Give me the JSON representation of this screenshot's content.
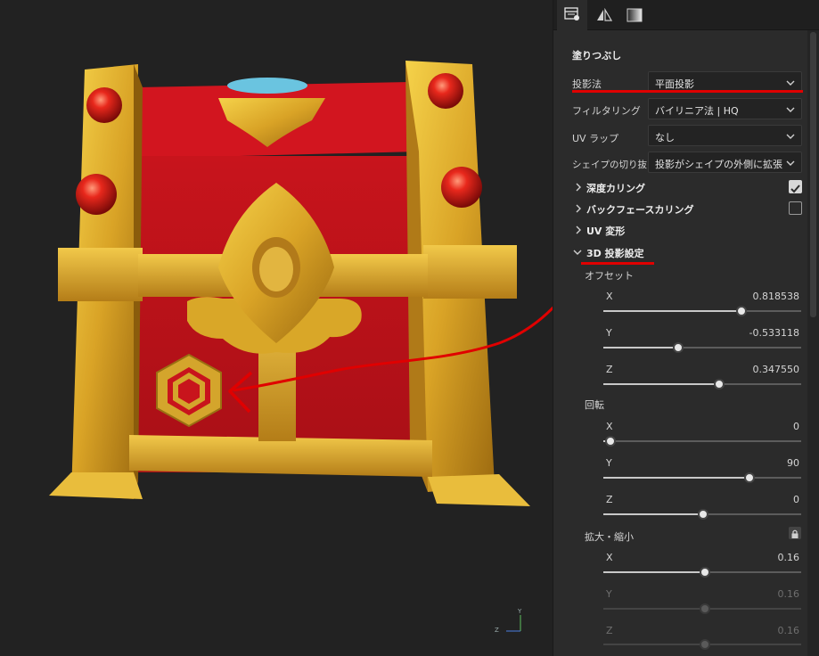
{
  "panel": {
    "section_title": "塗りつぶし",
    "rows": [
      {
        "label": "投影法",
        "value": "平面投影"
      },
      {
        "label": "フィルタリング",
        "value": "バイリニア法 | HQ"
      },
      {
        "label": "UV ラップ",
        "value": "なし"
      },
      {
        "label": "シェイプの切り抜き",
        "value": "投影がシェイプの外側に拡張"
      }
    ],
    "groups": {
      "depth_culling": {
        "label": "深度カリング",
        "checked": true
      },
      "backface_culling": {
        "label": "バックフェースカリング",
        "checked": false
      },
      "uv_transform": {
        "label": "UV 変形"
      },
      "projection_3d": {
        "label": "3D 投影設定",
        "expanded": true
      }
    },
    "offset": {
      "label": "オフセット",
      "x": {
        "label": "X",
        "value": "0.818538",
        "fraction": 0.696
      },
      "y": {
        "label": "Y",
        "value": "-0.533118",
        "fraction": 0.378
      },
      "z": {
        "label": "Z",
        "value": "0.347550",
        "fraction": 0.585
      }
    },
    "rotation": {
      "label": "回転",
      "x": {
        "label": "X",
        "value": "0",
        "fraction": 0.035
      },
      "y": {
        "label": "Y",
        "value": "90",
        "fraction": 0.738
      },
      "z": {
        "label": "Z",
        "value": "0",
        "fraction": 0.505
      }
    },
    "scale": {
      "label": "拡大・縮小",
      "x": {
        "label": "X",
        "value": "0.16",
        "fraction": 0.512
      },
      "y": {
        "label": "Y",
        "value": "0.16",
        "fraction": 0.512
      },
      "z": {
        "label": "Z",
        "value": "0.16",
        "fraction": 0.512
      }
    }
  },
  "viewport": {
    "axis": {
      "y_label": "Y",
      "z_label": "Z"
    }
  },
  "colors": {
    "panel_bg": "#2b2b2b",
    "annotation_red": "#e00000",
    "chest_red": "#c8141c",
    "chest_gold": "#d8a020"
  }
}
